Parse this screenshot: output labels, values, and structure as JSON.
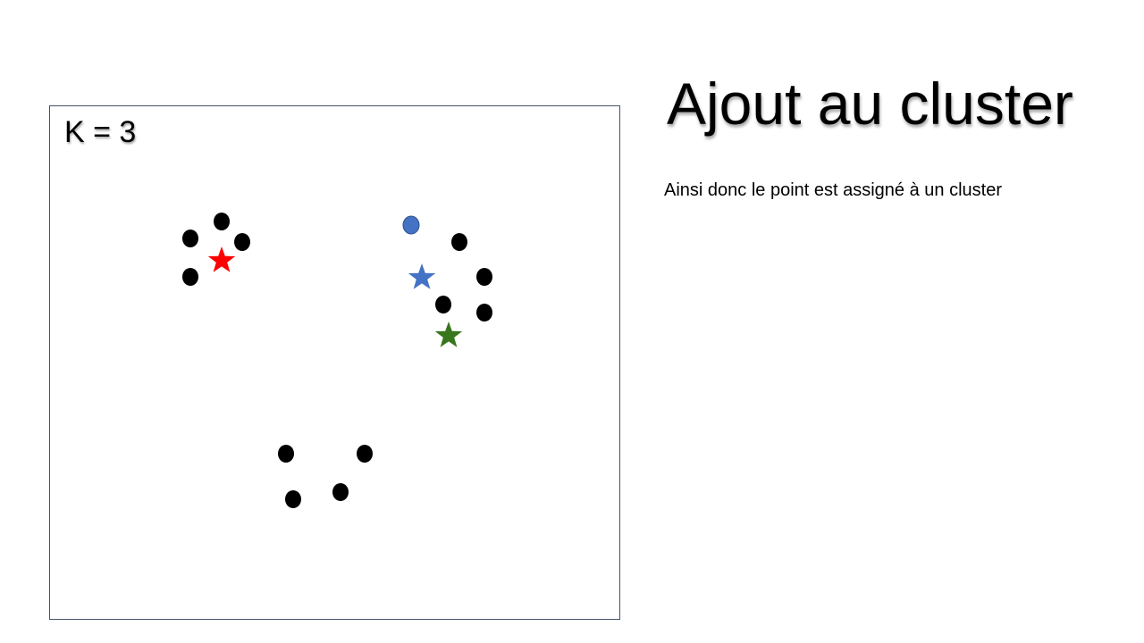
{
  "slide": {
    "title": "Ajout au cluster",
    "subtitle": "Ainsi donc le point est assigné à un cluster"
  },
  "diagram": {
    "k_label": "K = 3",
    "colors": {
      "point": "#000000",
      "new_point": "#4472c4",
      "centroid_red": "#ff0000",
      "centroid_blue": "#4472c4",
      "centroid_green": "#38761d",
      "border": "#44546a"
    },
    "points": [
      {
        "id": "p1",
        "group": "top-left"
      },
      {
        "id": "p2",
        "group": "top-left"
      },
      {
        "id": "p3",
        "group": "top-left"
      },
      {
        "id": "p4",
        "group": "top-left"
      },
      {
        "id": "p5",
        "group": "right"
      },
      {
        "id": "p6",
        "group": "right"
      },
      {
        "id": "p7",
        "group": "right"
      },
      {
        "id": "p8",
        "group": "right"
      },
      {
        "id": "p9",
        "group": "bottom"
      },
      {
        "id": "p10",
        "group": "bottom"
      },
      {
        "id": "p11",
        "group": "bottom"
      },
      {
        "id": "p12",
        "group": "bottom"
      }
    ],
    "new_point": {
      "id": "new",
      "color": "blue"
    },
    "centroids": [
      {
        "id": "c-red",
        "color": "red"
      },
      {
        "id": "c-blue",
        "color": "blue"
      },
      {
        "id": "c-green",
        "color": "green"
      }
    ]
  }
}
